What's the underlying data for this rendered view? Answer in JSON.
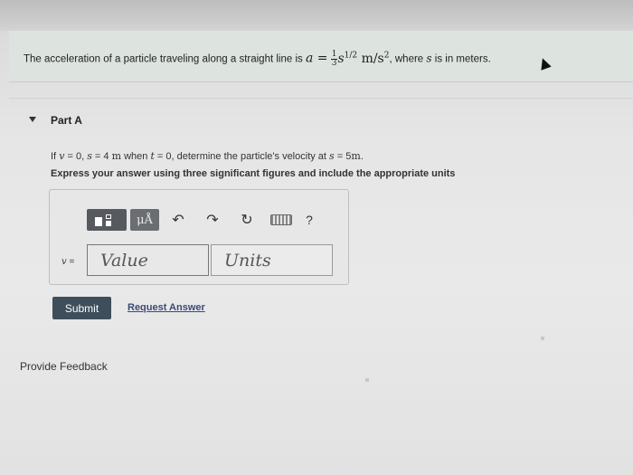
{
  "problem": {
    "text_before": "The acceleration of a particle traveling along a straight line is",
    "eq_lhs": "a =",
    "frac_num": "1",
    "frac_den": "3",
    "eq_base": "s",
    "eq_exp": "1/2",
    "eq_units": "m/s",
    "eq_units_exp": "2",
    "text_after": ", where",
    "var_s": "s",
    "text_end": "is in meters."
  },
  "part": {
    "title": "Part A",
    "question": {
      "if": "If",
      "v": "v",
      "eq0": "= 0,",
      "s": "s",
      "eq4": "= 4",
      "m1": "m",
      "when": "when",
      "t": "t",
      "eq0b": "= 0, determine the particle's velocity at",
      "s2": "s",
      "eq5": "= 5",
      "m2": "m",
      "period": "."
    },
    "instruction": "Express your answer using three significant figures and include the appropriate units"
  },
  "toolbar": {
    "mu_label": "μÅ",
    "help_label": "?"
  },
  "answer": {
    "variable": "v",
    "equals": "=",
    "value_placeholder": "Value",
    "units_placeholder": "Units"
  },
  "actions": {
    "submit": "Submit",
    "request_answer": "Request Answer"
  },
  "feedback": "Provide Feedback"
}
